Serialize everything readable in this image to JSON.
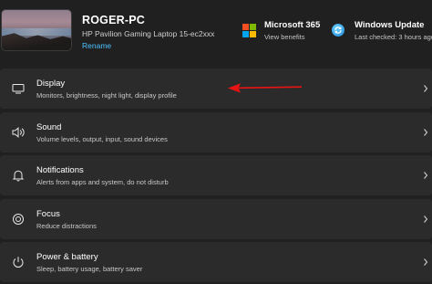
{
  "device": {
    "name": "ROGER-PC",
    "model": "HP Pavilion Gaming Laptop 15-ec2xxx",
    "rename_label": "Rename"
  },
  "microsoft365": {
    "title": "Microsoft 365",
    "subtitle": "View benefits"
  },
  "windows_update": {
    "title": "Windows Update",
    "subtitle": "Last checked: 3 hours ago"
  },
  "settings": [
    {
      "title": "Display",
      "description": "Monitors, brightness, night light, display profile",
      "icon": "monitor-icon"
    },
    {
      "title": "Sound",
      "description": "Volume levels, output, input, sound devices",
      "icon": "speaker-icon"
    },
    {
      "title": "Notifications",
      "description": "Alerts from apps and system, do not disturb",
      "icon": "bell-icon"
    },
    {
      "title": "Focus",
      "description": "Reduce distractions",
      "icon": "focus-icon"
    },
    {
      "title": "Power & battery",
      "description": "Sleep, battery usage, battery saver",
      "icon": "power-icon"
    }
  ],
  "colors": {
    "background": "#202020",
    "card": "#2b2b2b",
    "accent_link": "#4cc2ff",
    "annotation_arrow": "#e81414"
  }
}
